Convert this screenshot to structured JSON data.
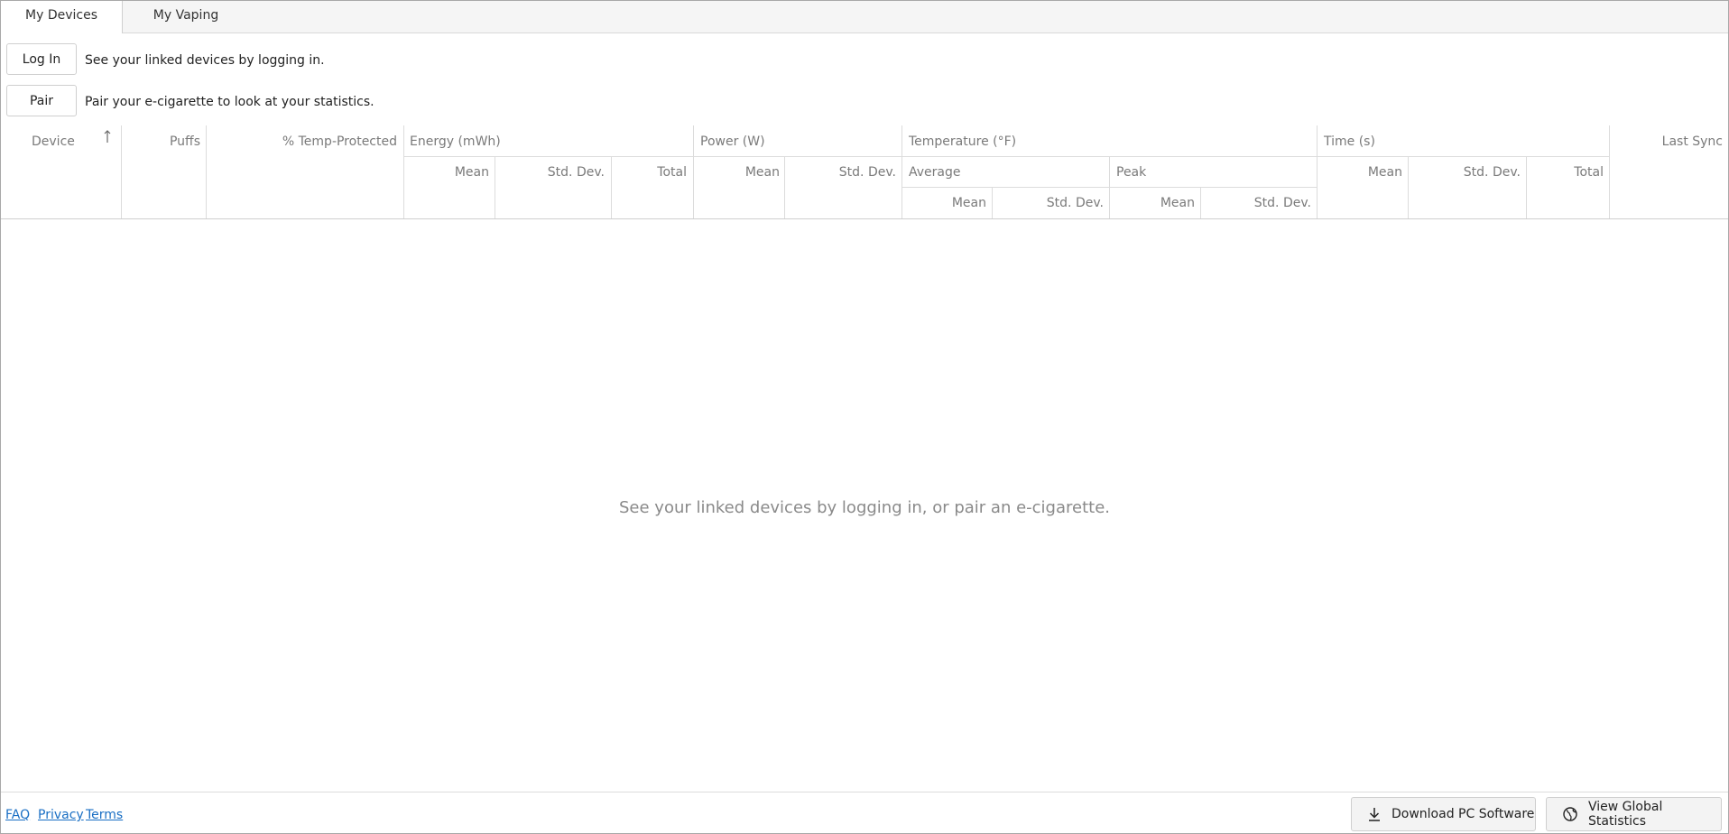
{
  "tabs": [
    {
      "label": "My Devices",
      "active": true
    },
    {
      "label": "My Vaping",
      "active": false
    }
  ],
  "actions": {
    "login_label": "Log In",
    "login_text": "See your linked devices by logging in.",
    "pair_label": "Pair",
    "pair_text": "Pair your e-cigarette to look at your statistics."
  },
  "table": {
    "device": "Device",
    "sort_icon": "sort-ascending-arrow",
    "puffs": "Puffs",
    "temp_protected": "% Temp-Protected",
    "energy": {
      "label": "Energy (mWh)",
      "mean": "Mean",
      "std": "Std. Dev.",
      "total": "Total"
    },
    "power": {
      "label": "Power (W)",
      "mean": "Mean",
      "std": "Std. Dev."
    },
    "temperature": {
      "label": "Temperature (°F)",
      "average": {
        "label": "Average",
        "mean": "Mean",
        "std": "Std. Dev."
      },
      "peak": {
        "label": "Peak",
        "mean": "Mean",
        "std": "Std. Dev."
      }
    },
    "time": {
      "label": "Time (s)",
      "mean": "Mean",
      "std": "Std. Dev.",
      "total": "Total"
    },
    "last_sync": "Last Sync",
    "empty_message": "See your linked devices by logging in, or pair an e-cigarette."
  },
  "footer": {
    "links": [
      "FAQ",
      "Privacy",
      "Terms"
    ],
    "download_label": "Download PC Software",
    "download_icon": "download-icon",
    "global_label": "View Global Statistics",
    "global_icon": "globe-icon"
  },
  "colors": {
    "link": "#1a6fc4",
    "header_text": "#7a7a7a",
    "empty_text": "#8a8a8a"
  }
}
